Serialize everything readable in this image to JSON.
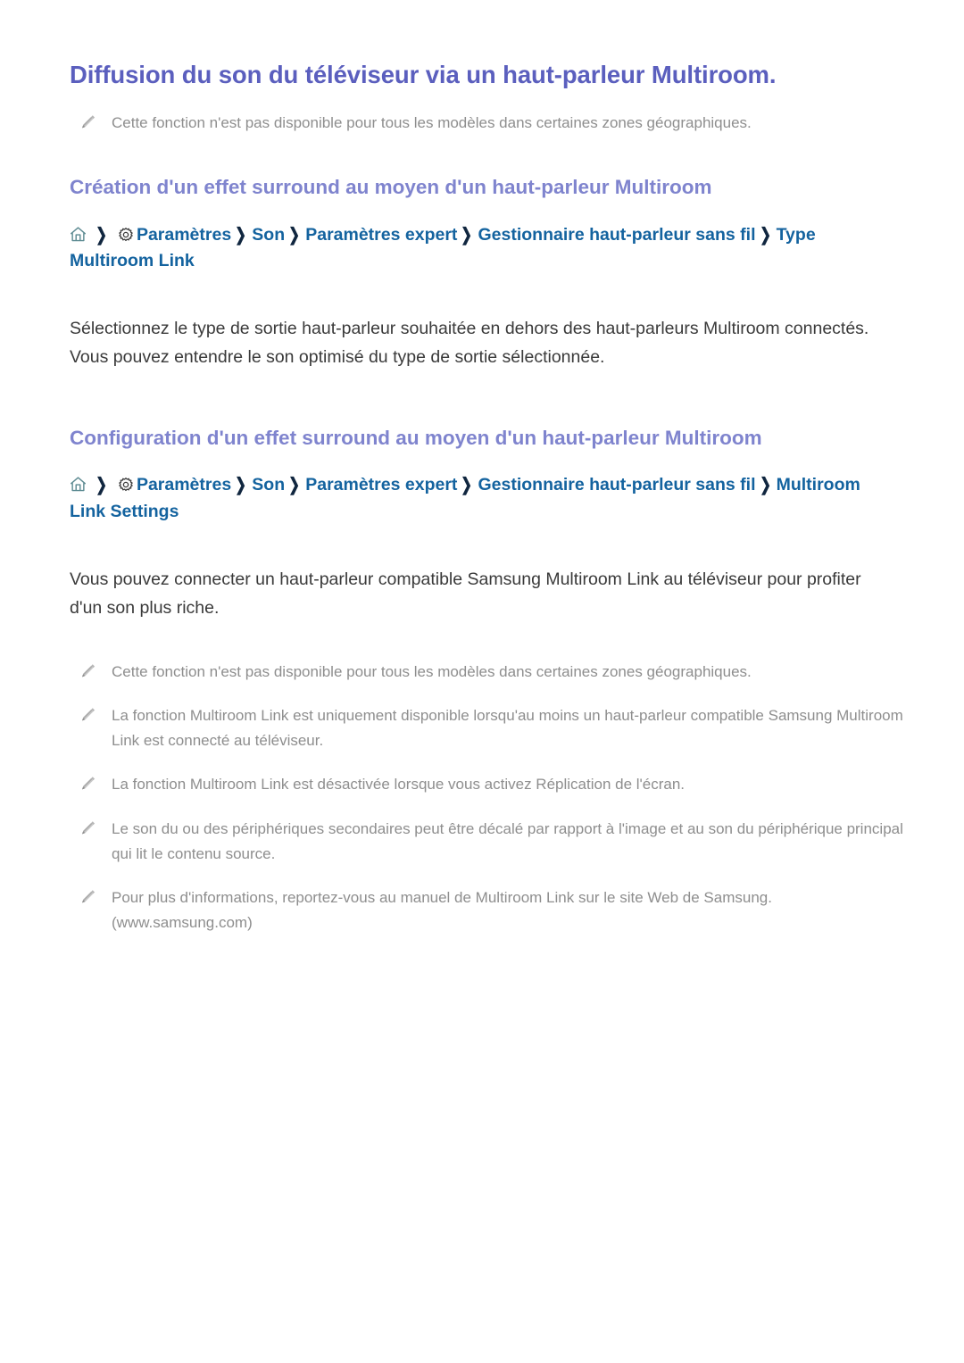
{
  "document": {
    "title": "Diffusion du son du téléviseur via un haut-parleur Multiroom.",
    "colors": {
      "page_title": "#5b5fbe",
      "section_heading": "#7f84ce",
      "breadcrumb_link": "#14639f",
      "breadcrumb_separator": "#10263f",
      "body_text": "#3a3a3a",
      "note_text": "#8e8e8e",
      "home_icon": "#5d8b92",
      "gear_icon": "#3b3b3b",
      "pencil_icon": "#b0b0b0",
      "background": "#ffffff"
    },
    "intro_notes": [
      {
        "icon": "pencil-icon",
        "text": "Cette fonction n'est pas disponible pour tous les modèles dans certaines zones géographiques."
      }
    ],
    "sections": [
      {
        "heading": "Création d'un effet surround au moyen d'un haut-parleur Multiroom",
        "breadcrumb": {
          "icons": [
            "home-icon",
            "gear-icon"
          ],
          "separator": "❯",
          "crumbs": [
            "Paramètres",
            "Son",
            "Paramètres expert",
            "Gestionnaire haut-parleur sans fil",
            "Type Multiroom Link"
          ]
        },
        "paragraphs": [
          "Sélectionnez le type de sortie haut-parleur souhaitée en dehors des haut-parleurs Multiroom connectés. Vous pouvez entendre le son optimisé du type de sortie sélectionnée."
        ],
        "notes": []
      },
      {
        "heading": "Configuration d'un effet surround au moyen d'un haut-parleur Multiroom",
        "breadcrumb": {
          "icons": [
            "home-icon",
            "gear-icon"
          ],
          "separator": "❯",
          "crumbs": [
            "Paramètres",
            "Son",
            "Paramètres expert",
            "Gestionnaire haut-parleur sans fil",
            "Multiroom Link Settings"
          ]
        },
        "paragraphs": [
          "Vous pouvez connecter un haut-parleur compatible Samsung Multiroom Link au téléviseur pour profiter d'un son plus riche."
        ],
        "notes": [
          {
            "icon": "pencil-icon",
            "text": "Cette fonction n'est pas disponible pour tous les modèles dans certaines zones géographiques."
          },
          {
            "icon": "pencil-icon",
            "text": "La fonction Multiroom Link est uniquement disponible lorsqu'au moins un haut-parleur compatible Samsung Multiroom Link est connecté au téléviseur."
          },
          {
            "icon": "pencil-icon",
            "text": "La fonction Multiroom Link est désactivée lorsque vous activez Réplication de l'écran."
          },
          {
            "icon": "pencil-icon",
            "text": "Le son du ou des périphériques secondaires peut être décalé par rapport à l'image et au son du périphérique principal qui lit le contenu source."
          },
          {
            "icon": "pencil-icon",
            "text": "Pour plus d'informations, reportez-vous au manuel de Multiroom Link sur le site Web de Samsung. (www.samsung.com)"
          }
        ]
      }
    ]
  }
}
